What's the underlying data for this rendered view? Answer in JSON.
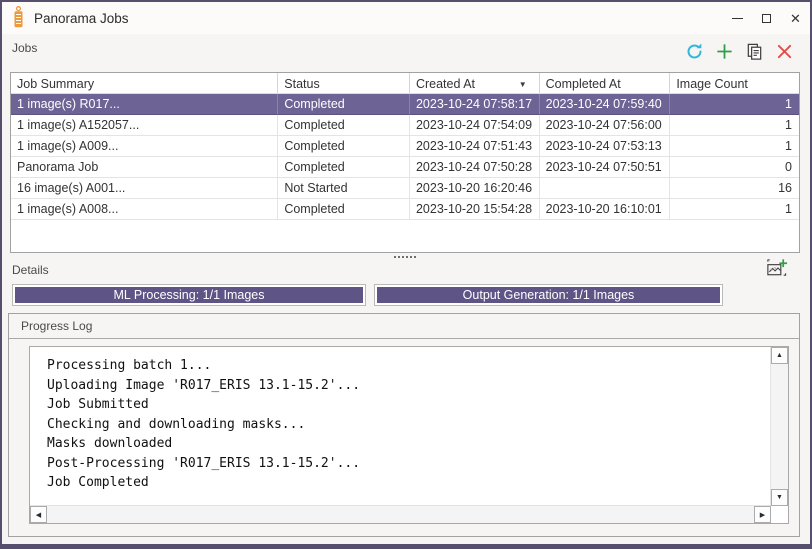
{
  "window": {
    "title": "Panorama Jobs",
    "controls": {
      "minimize": "minimize",
      "maximize": "maximize",
      "close": "✕"
    }
  },
  "colors": {
    "accent_purple": "#6d6394",
    "progress_fill": "#5e5486",
    "window_border": "#56506e",
    "app_icon_orange": "#ed9a3c",
    "refresh_icon": "#35b6d9",
    "add_icon": "#2f9e49",
    "copy_icon": "#3f3f3f",
    "delete_icon": "#e04d4a"
  },
  "jobs_panel": {
    "label": "Jobs",
    "toolbar_icons": [
      "refresh-icon",
      "add-icon",
      "copy-icon",
      "delete-icon"
    ]
  },
  "jobs_table": {
    "columns": [
      {
        "label": "Job Summary"
      },
      {
        "label": "Status"
      },
      {
        "label": "Created At",
        "sort": "desc"
      },
      {
        "label": "Completed At"
      },
      {
        "label": "Image Count"
      }
    ],
    "rows": [
      {
        "job_summary": "1 image(s) R017...",
        "status": "Completed",
        "created_at": "2023-10-24 07:58:17",
        "completed_at": "2023-10-24 07:59:40",
        "image_count": "1",
        "selected": true
      },
      {
        "job_summary": "1 image(s) A152057...",
        "status": "Completed",
        "created_at": "2023-10-24 07:54:09",
        "completed_at": "2023-10-24 07:56:00",
        "image_count": "1",
        "selected": false
      },
      {
        "job_summary": "1 image(s) A009...",
        "status": "Completed",
        "created_at": "2023-10-24 07:51:43",
        "completed_at": "2023-10-24 07:53:13",
        "image_count": "1",
        "selected": false
      },
      {
        "job_summary": "Panorama Job",
        "status": "Completed",
        "created_at": "2023-10-24 07:50:28",
        "completed_at": "2023-10-24 07:50:51",
        "image_count": "0",
        "selected": false
      },
      {
        "job_summary": "16 image(s) A001...",
        "status": "Not Started",
        "created_at": "2023-10-20 16:20:46",
        "completed_at": "",
        "image_count": "16",
        "selected": false
      },
      {
        "job_summary": "1 image(s) A008...",
        "status": "Completed",
        "created_at": "2023-10-20 15:54:28",
        "completed_at": "2023-10-20 16:10:01",
        "image_count": "1",
        "selected": false
      }
    ]
  },
  "details_panel": {
    "label": "Details",
    "add_image_icon": "add-image-icon",
    "progress_bars": [
      {
        "label": "ML Processing: 1/1 Images",
        "percent": 100
      },
      {
        "label": "Output Generation: 1/1 Images",
        "percent": 100
      }
    ]
  },
  "progress_log": {
    "title": "Progress Log",
    "lines": [
      "Processing batch 1...",
      "Uploading Image 'R017_ERIS 13.1-15.2'...",
      "Job Submitted",
      "Checking and downloading masks...",
      "Masks downloaded",
      "Post-Processing 'R017_ERIS 13.1-15.2'...",
      "Job Completed"
    ]
  }
}
